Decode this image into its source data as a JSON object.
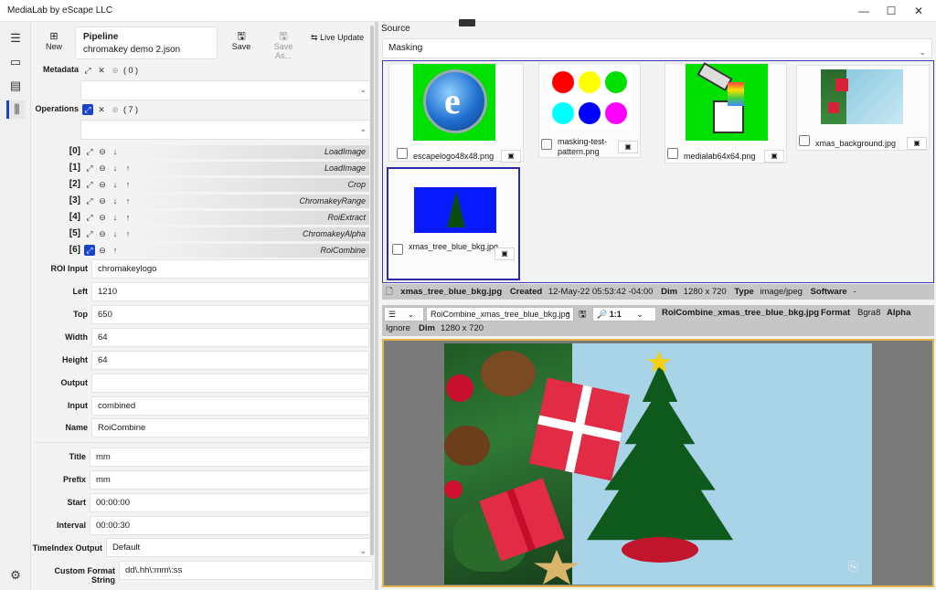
{
  "window": {
    "title": "MediaLab by eScape LLC",
    "minimize_icon": "minimize-icon",
    "maximize_icon": "maximize-icon",
    "close_icon": "close-icon"
  },
  "rail": {
    "icons": [
      "hamburger-menu-icon",
      "video-icon",
      "film-icon",
      "library-icon",
      "settings-icon"
    ]
  },
  "toolbar": {
    "new_label": "New",
    "pipeline_heading": "Pipeline",
    "pipeline_file": "chromakey demo 2.json",
    "save_label": "Save",
    "save_as_label": "Save As...",
    "live_update_label": "Live Update"
  },
  "metadata": {
    "label": "Metadata",
    "count": "( 0 )"
  },
  "operations": {
    "label": "Operations",
    "count": "( 7 )",
    "items": [
      {
        "index": "[0]",
        "name": "LoadImage"
      },
      {
        "index": "[1]",
        "name": "LoadImage"
      },
      {
        "index": "[2]",
        "name": "Crop"
      },
      {
        "index": "[3]",
        "name": "ChromakeyRange"
      },
      {
        "index": "[4]",
        "name": "RoiExtract"
      },
      {
        "index": "[5]",
        "name": "ChromakeyAlpha"
      },
      {
        "index": "[6]",
        "name": "RoiCombine"
      }
    ]
  },
  "properties": [
    {
      "label": "ROI Input",
      "value": "chromakeylogo"
    },
    {
      "label": "Left",
      "value": "1210"
    },
    {
      "label": "Top",
      "value": "650"
    },
    {
      "label": "Width",
      "value": "64"
    },
    {
      "label": "Height",
      "value": "64"
    },
    {
      "label": "Output",
      "value": ""
    },
    {
      "label": "Input",
      "value": "combined"
    },
    {
      "label": "Name",
      "value": "RoiCombine"
    }
  ],
  "timeprops": [
    {
      "label": "Title",
      "value": "mm"
    },
    {
      "label": "Prefix",
      "value": "mm"
    },
    {
      "label": "Start",
      "value": "00:00:00"
    },
    {
      "label": "Interval",
      "value": "00:00:30"
    }
  ],
  "timeindex": {
    "label": "TimeIndex Output",
    "value": "Default"
  },
  "customformat": {
    "label": "Custom Format String",
    "value": "dd\\.hh\\:mm\\:ss"
  },
  "source": {
    "label": "Source",
    "selected": "Masking"
  },
  "gallery": [
    {
      "name": "escapelogo48x48.png"
    },
    {
      "name": "masking-test-pattern.png"
    },
    {
      "name": "medialab64x64.png"
    },
    {
      "name": "xmas_background.jpg"
    },
    {
      "name": "xmas_tree_blue_bkg.jpg"
    }
  ],
  "info": {
    "file": "xmas_tree_blue_bkg.jpg",
    "created_label": "Created",
    "created": "12-May-22 05:53:42 -04:00",
    "dim_label": "Dim",
    "dim": "1280 x 720",
    "type_label": "Type",
    "type": "image/jpeg",
    "software_label": "Software",
    "software": "-"
  },
  "viewer": {
    "output_select": "RoiCombine_xmas_tree_blue_bkg.jpg",
    "zoom": "1:1",
    "title": "RoiCombine_xmas_tree_blue_bkg.jpg",
    "format_label": "Format",
    "format": "Bgra8",
    "alpha_label": "Alpha",
    "alpha": "Ignore",
    "dim_label": "Dim",
    "dim": "1280 x 720"
  }
}
